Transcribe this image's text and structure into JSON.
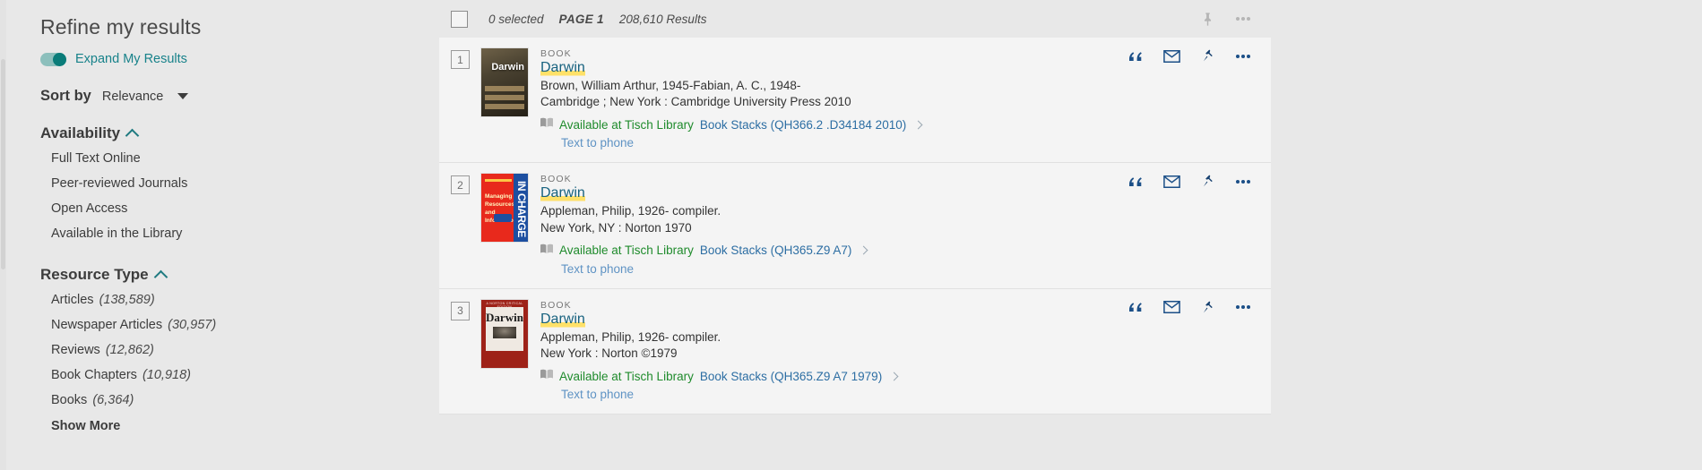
{
  "sidebar": {
    "title": "Refine my results",
    "expand_toggle": {
      "label": "Expand My Results",
      "enabled": true
    },
    "sort": {
      "label": "Sort by",
      "value": "Relevance"
    },
    "facets": [
      {
        "name": "Availability",
        "expanded": true,
        "items": [
          {
            "label": "Full Text Online",
            "count": ""
          },
          {
            "label": "Peer-reviewed Journals",
            "count": ""
          },
          {
            "label": "Open Access",
            "count": ""
          },
          {
            "label": "Available in the Library",
            "count": ""
          }
        ],
        "show_more": ""
      },
      {
        "name": "Resource Type",
        "expanded": true,
        "items": [
          {
            "label": "Articles",
            "count": "(138,589)"
          },
          {
            "label": "Newspaper Articles",
            "count": "(30,957)"
          },
          {
            "label": "Reviews",
            "count": "(12,862)"
          },
          {
            "label": "Book Chapters",
            "count": "(10,918)"
          },
          {
            "label": "Books",
            "count": "(6,364)"
          }
        ],
        "show_more": "Show More"
      }
    ]
  },
  "toolbar": {
    "selected_text": "0 selected",
    "page_text": "PAGE 1",
    "results_text": "208,610 Results",
    "pin_icon": "pin-icon",
    "more_icon": "ellipsis-icon"
  },
  "results": [
    {
      "index": "1",
      "type": "BOOK",
      "title": "Darwin",
      "authors": "Brown, William Arthur, 1945-Fabian, A. C., 1948-",
      "publication": "Cambridge ; New York : Cambridge University Press 2010",
      "availability_status": "Available at Tisch Library",
      "availability_location": "Book Stacks (QH366.2 .D34184 2010)",
      "text_to_phone": "Text to phone",
      "cover_title": "Darwin",
      "cover_style": "cover-a"
    },
    {
      "index": "2",
      "type": "BOOK",
      "title": "Darwin",
      "authors": "Appleman, Philip, 1926- compiler.",
      "publication": "New York, NY : Norton 1970",
      "availability_status": "Available at Tisch Library",
      "availability_location": "Book Stacks (QH365.Z9 A7)",
      "text_to_phone": "Text to phone",
      "cover_title": "IN CHARGE",
      "cover_subtitle": "Managing Resources and Information",
      "cover_style": "cover-b"
    },
    {
      "index": "3",
      "type": "BOOK",
      "title": "Darwin",
      "authors": "Appleman, Philip, 1926- compiler.",
      "publication": "New York : Norton ©1979",
      "availability_status": "Available at Tisch Library",
      "availability_location": "Book Stacks (QH365.Z9 A7 1979)",
      "text_to_phone": "Text to phone",
      "cover_title": "Darwin",
      "cover_caption": "A NORTON CRITICAL EDITION",
      "cover_style": "cover-c"
    }
  ],
  "row_actions": {
    "citation_icon": "quote-icon",
    "email_icon": "envelope-icon",
    "pin_icon": "pin-icon",
    "more_icon": "ellipsis-icon"
  },
  "colors": {
    "accent_teal": "#18828a",
    "link_blue": "#18627f",
    "available_green": "#1f8b2c",
    "highlight_yellow": "#ffe169",
    "action_navy": "#1b4f87",
    "page_bg": "#e8e8e8",
    "card_bg": "#f4f4f4"
  }
}
